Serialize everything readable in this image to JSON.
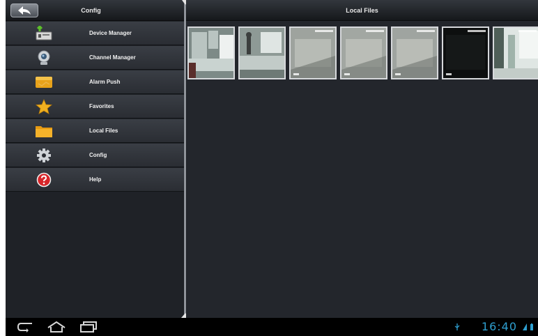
{
  "left_panel": {
    "title": "Config",
    "back_icon": "back-arrow-icon",
    "menu": [
      {
        "label": "Device Manager",
        "icon": "device-manager-icon"
      },
      {
        "label": "Channel Manager",
        "icon": "camera-icon"
      },
      {
        "label": "Alarm Push",
        "icon": "alarm-push-icon"
      },
      {
        "label": "Favorites",
        "icon": "star-icon"
      },
      {
        "label": "Local Files",
        "icon": "folder-icon"
      },
      {
        "label": "Config",
        "icon": "gear-icon"
      },
      {
        "label": "Help",
        "icon": "help-icon"
      }
    ]
  },
  "right_panel": {
    "title": "Local Files",
    "thumbnails": [
      {
        "kind": "photo-room",
        "colors": [
          "#7d8a87",
          "#b9c4c1",
          "#5a2e2b"
        ]
      },
      {
        "kind": "photo-stairs",
        "colors": [
          "#8e9a96",
          "#c2cbc8",
          "#3c3f3e"
        ]
      },
      {
        "kind": "grey-snapshot",
        "colors": [
          "#9ea39e",
          "#b7bbb5",
          "#6e736e"
        ]
      },
      {
        "kind": "grey-snapshot",
        "colors": [
          "#a2a7a2",
          "#babdb7",
          "#737873"
        ]
      },
      {
        "kind": "grey-snapshot",
        "colors": [
          "#9fa4a0",
          "#b9bcb6",
          "#6f746f"
        ]
      },
      {
        "kind": "dark-snapshot",
        "colors": [
          "#0d0f0f",
          "#151818",
          "#0a0a0a"
        ]
      },
      {
        "kind": "photo-bright",
        "colors": [
          "#dfe6e3",
          "#4f5f58",
          "#f3f6f4"
        ]
      }
    ]
  },
  "nav_bar": {
    "buttons": [
      {
        "icon": "back-nav-icon"
      },
      {
        "icon": "home-icon"
      },
      {
        "icon": "recent-apps-icon"
      }
    ],
    "time": "16:40",
    "status_icons": [
      "usb-icon",
      "signal-icon",
      "battery-icon"
    ]
  },
  "colors": {
    "accent_blue": "#2e9fd0",
    "menu_bg": "#33373d",
    "pane_bg": "#23262c"
  }
}
